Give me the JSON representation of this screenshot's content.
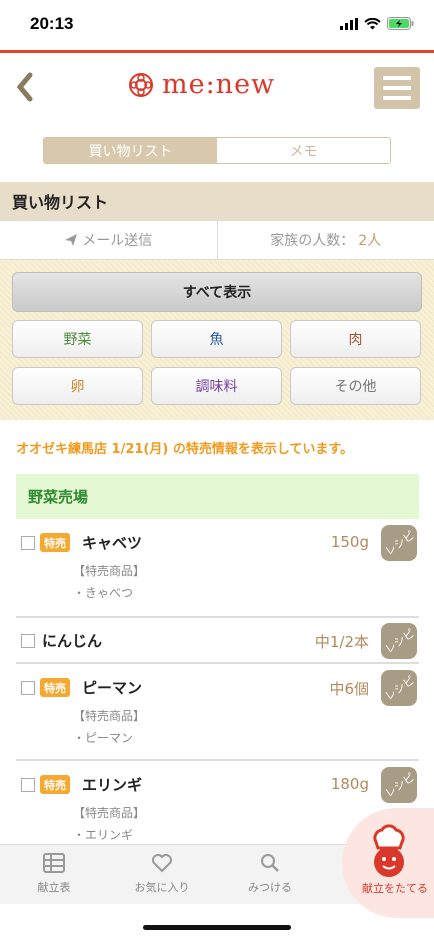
{
  "status_bar": {
    "time": "20:13"
  },
  "header": {
    "logo_text": "me:new"
  },
  "segment": {
    "tabs": [
      {
        "label": "買い物リスト",
        "active": true
      },
      {
        "label": "メモ",
        "active": false
      }
    ]
  },
  "section_title": "買い物リスト",
  "actions": {
    "mail_label": "メール送信",
    "family_label": "家族の人数：",
    "family_count": "2人"
  },
  "filters": {
    "show_all": "すべて表示",
    "categories": [
      {
        "label": "野菜",
        "color": "#4e8a3a"
      },
      {
        "label": "魚",
        "color": "#2c5aa0"
      },
      {
        "label": "肉",
        "color": "#a0522d"
      },
      {
        "label": "卵",
        "color": "#c98b2f"
      },
      {
        "label": "調味料",
        "color": "#7a3fa0"
      },
      {
        "label": "その他",
        "color": "#777777"
      }
    ]
  },
  "notice": "オオゼキ練馬店 1/21(月) の特売情報を表示しています。",
  "category_header": "野菜売場",
  "items": [
    {
      "name": "キャベツ",
      "qty": "150g",
      "tokubai": "特売",
      "recipe": "レシピ",
      "sub_label": "【特売商品】",
      "sub_item": "・きゃべつ"
    },
    {
      "name": "にんじん",
      "qty": "中1/2本",
      "recipe": "レシピ"
    },
    {
      "name": "ピーマン",
      "qty": "中6個",
      "tokubai": "特売",
      "recipe": "レシピ",
      "sub_label": "【特売商品】",
      "sub_item": "・ピーマン"
    },
    {
      "name": "エリンギ",
      "qty": "180g",
      "tokubai": "特売",
      "recipe": "レシピ",
      "sub_label": "【特売商品】",
      "sub_item": "・エリンギ"
    }
  ],
  "tab_bar": {
    "tabs": [
      {
        "label": "献立表"
      },
      {
        "label": "お気に入り"
      },
      {
        "label": "みつける"
      }
    ],
    "kondate_label": "献立をたてる"
  },
  "colors": {
    "accent_red": "#e8412e",
    "beige": "#d3c3a8",
    "orange": "#f39a1e"
  }
}
